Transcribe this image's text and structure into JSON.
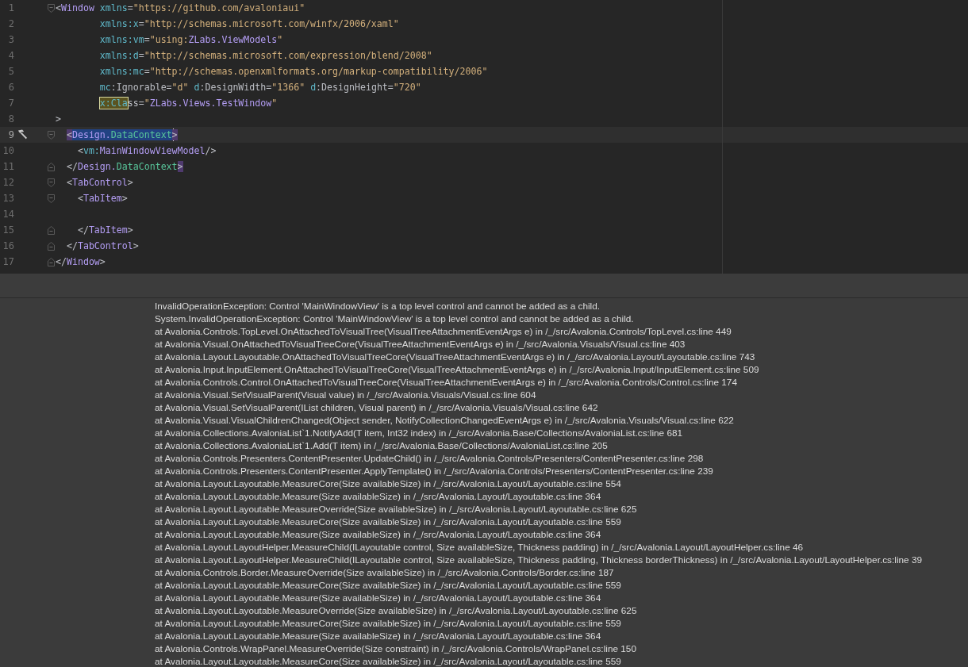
{
  "editor": {
    "lines": [
      {
        "number": "1",
        "fold_start": true,
        "fold_end": false,
        "current": false,
        "build_marker": false,
        "tokens": [
          {
            "kind": "punct",
            "text": "<"
          },
          {
            "kind": "tag",
            "text": "Window "
          },
          {
            "kind": "attr",
            "text": "xmlns"
          },
          {
            "kind": "punct",
            "text": "="
          },
          {
            "kind": "string",
            "text": "\"https://github.com/avaloniaui\""
          }
        ]
      },
      {
        "number": "2",
        "fold_start": false,
        "fold_end": false,
        "current": false,
        "build_marker": false,
        "tokens": [
          {
            "kind": "attr",
            "text": "        xmlns:x"
          },
          {
            "kind": "punct",
            "text": "="
          },
          {
            "kind": "string",
            "text": "\"http://schemas.microsoft.com/winfx/2006/xaml\""
          }
        ]
      },
      {
        "number": "3",
        "fold_start": false,
        "fold_end": false,
        "current": false,
        "build_marker": false,
        "tokens": [
          {
            "kind": "attr",
            "text": "        xmlns:vm"
          },
          {
            "kind": "punct",
            "text": "="
          },
          {
            "kind": "string",
            "text": "\"using:"
          },
          {
            "kind": "ref",
            "text": "ZLabs.ViewModels"
          },
          {
            "kind": "string",
            "text": "\""
          }
        ]
      },
      {
        "number": "4",
        "fold_start": false,
        "fold_end": false,
        "current": false,
        "build_marker": false,
        "tokens": [
          {
            "kind": "attr",
            "text": "        xmlns:d"
          },
          {
            "kind": "punct",
            "text": "="
          },
          {
            "kind": "string",
            "text": "\"http://schemas.microsoft.com/expression/blend/2008\""
          }
        ]
      },
      {
        "number": "5",
        "fold_start": false,
        "fold_end": false,
        "current": false,
        "build_marker": false,
        "tokens": [
          {
            "kind": "attr",
            "text": "        xmlns:mc"
          },
          {
            "kind": "punct",
            "text": "="
          },
          {
            "kind": "string",
            "text": "\"http://schemas.openxmlformats.org/markup-compatibility/2006\""
          }
        ]
      },
      {
        "number": "6",
        "fold_start": false,
        "fold_end": false,
        "current": false,
        "build_marker": false,
        "tokens": [
          {
            "kind": "attr",
            "text": "        mc"
          },
          {
            "kind": "punct",
            "text": ":Ignorable="
          },
          {
            "kind": "string",
            "text": "\"d\" "
          },
          {
            "kind": "attr",
            "text": "d"
          },
          {
            "kind": "punct",
            "text": ":DesignWidth="
          },
          {
            "kind": "string",
            "text": "\"1366\" "
          },
          {
            "kind": "attr",
            "text": "d"
          },
          {
            "kind": "punct",
            "text": ":DesignHeight="
          },
          {
            "kind": "string",
            "text": "\"720\""
          }
        ]
      },
      {
        "number": "7",
        "fold_start": false,
        "fold_end": false,
        "current": false,
        "build_marker": false,
        "tokens": [
          {
            "kind": "attr",
            "text": "        x:Cla",
            "search_match": true
          },
          {
            "kind": "punct",
            "text": "ss="
          },
          {
            "kind": "string",
            "text": "\""
          },
          {
            "kind": "ref",
            "text": "ZLabs.Views.TestWindow"
          },
          {
            "kind": "string",
            "text": "\""
          }
        ]
      },
      {
        "number": "8",
        "fold_start": false,
        "fold_end": false,
        "current": false,
        "build_marker": false,
        "tokens": [
          {
            "kind": "punct",
            "text": ">"
          }
        ]
      },
      {
        "number": "9",
        "fold_start": true,
        "fold_end": false,
        "current": true,
        "build_marker": true,
        "tokens": [
          {
            "kind": "punct",
            "text": "  <",
            "bracket_match": true
          },
          {
            "kind": "tag",
            "text": "Design.",
            "selected": true
          },
          {
            "kind": "green",
            "text": "DataContext",
            "selected": true,
            "caret": true
          },
          {
            "kind": "punct",
            "text": ">",
            "bracket_match": true
          }
        ]
      },
      {
        "number": "10",
        "fold_start": false,
        "fold_end": false,
        "current": false,
        "build_marker": false,
        "tokens": [
          {
            "kind": "punct",
            "text": "    <"
          },
          {
            "kind": "attr",
            "text": "vm:"
          },
          {
            "kind": "tag",
            "text": "MainWindowViewModel"
          },
          {
            "kind": "punct",
            "text": "/>"
          }
        ]
      },
      {
        "number": "11",
        "fold_start": false,
        "fold_end": true,
        "current": false,
        "build_marker": false,
        "tokens": [
          {
            "kind": "punct",
            "text": "  </"
          },
          {
            "kind": "tag",
            "text": "Design."
          },
          {
            "kind": "green",
            "text": "DataContext"
          },
          {
            "kind": "punct",
            "text": ">",
            "bracket_match": true
          }
        ]
      },
      {
        "number": "12",
        "fold_start": true,
        "fold_end": false,
        "current": false,
        "build_marker": false,
        "tokens": [
          {
            "kind": "punct",
            "text": "  <"
          },
          {
            "kind": "tag",
            "text": "TabControl"
          },
          {
            "kind": "punct",
            "text": ">"
          }
        ]
      },
      {
        "number": "13",
        "fold_start": true,
        "fold_end": false,
        "current": false,
        "build_marker": false,
        "tokens": [
          {
            "kind": "punct",
            "text": "    <"
          },
          {
            "kind": "tag",
            "text": "TabItem"
          },
          {
            "kind": "punct",
            "text": ">"
          }
        ]
      },
      {
        "number": "14",
        "fold_start": false,
        "fold_end": false,
        "current": false,
        "build_marker": false
      },
      {
        "number": "15",
        "fold_start": false,
        "fold_end": true,
        "current": false,
        "build_marker": false,
        "tokens": [
          {
            "kind": "punct",
            "text": "    </"
          },
          {
            "kind": "tag",
            "text": "TabItem"
          },
          {
            "kind": "punct",
            "text": ">"
          }
        ]
      },
      {
        "number": "16",
        "fold_start": false,
        "fold_end": true,
        "current": false,
        "build_marker": false,
        "tokens": [
          {
            "kind": "punct",
            "text": "  </"
          },
          {
            "kind": "tag",
            "text": "TabControl"
          },
          {
            "kind": "punct",
            "text": ">"
          }
        ]
      },
      {
        "number": "17",
        "fold_start": false,
        "fold_end": true,
        "current": false,
        "build_marker": false,
        "tokens": [
          {
            "kind": "punct",
            "text": "</"
          },
          {
            "kind": "tag",
            "text": "Window"
          },
          {
            "kind": "punct",
            "text": ">"
          }
        ]
      }
    ]
  },
  "error_panel": {
    "lines": [
      "InvalidOperationException: Control 'MainWindowView' is a top level control and cannot be added as a child.",
      "System.InvalidOperationException: Control 'MainWindowView' is a top level control and cannot be added as a child.",
      "at Avalonia.Controls.TopLevel.OnAttachedToVisualTree(VisualTreeAttachmentEventArgs e) in /_/src/Avalonia.Controls/TopLevel.cs:line 449",
      "at Avalonia.Visual.OnAttachedToVisualTreeCore(VisualTreeAttachmentEventArgs e) in /_/src/Avalonia.Visuals/Visual.cs:line 403",
      "at Avalonia.Layout.Layoutable.OnAttachedToVisualTreeCore(VisualTreeAttachmentEventArgs e) in /_/src/Avalonia.Layout/Layoutable.cs:line 743",
      "at Avalonia.Input.InputElement.OnAttachedToVisualTreeCore(VisualTreeAttachmentEventArgs e) in /_/src/Avalonia.Input/InputElement.cs:line 509",
      "at Avalonia.Controls.Control.OnAttachedToVisualTreeCore(VisualTreeAttachmentEventArgs e) in /_/src/Avalonia.Controls/Control.cs:line 174",
      "at Avalonia.Visual.SetVisualParent(Visual value) in /_/src/Avalonia.Visuals/Visual.cs:line 604",
      "at Avalonia.Visual.SetVisualParent(IList children, Visual parent) in /_/src/Avalonia.Visuals/Visual.cs:line 642",
      "at Avalonia.Visual.VisualChildrenChanged(Object sender, NotifyCollectionChangedEventArgs e) in /_/src/Avalonia.Visuals/Visual.cs:line 622",
      "at Avalonia.Collections.AvaloniaList`1.NotifyAdd(T item, Int32 index) in /_/src/Avalonia.Base/Collections/AvaloniaList.cs:line 681",
      "at Avalonia.Collections.AvaloniaList`1.Add(T item) in /_/src/Avalonia.Base/Collections/AvaloniaList.cs:line 205",
      "at Avalonia.Controls.Presenters.ContentPresenter.UpdateChild() in /_/src/Avalonia.Controls/Presenters/ContentPresenter.cs:line 298",
      "at Avalonia.Controls.Presenters.ContentPresenter.ApplyTemplate() in /_/src/Avalonia.Controls/Presenters/ContentPresenter.cs:line 239",
      "at Avalonia.Layout.Layoutable.MeasureCore(Size availableSize) in /_/src/Avalonia.Layout/Layoutable.cs:line 554",
      "at Avalonia.Layout.Layoutable.Measure(Size availableSize) in /_/src/Avalonia.Layout/Layoutable.cs:line 364",
      "at Avalonia.Layout.Layoutable.MeasureOverride(Size availableSize) in /_/src/Avalonia.Layout/Layoutable.cs:line 625",
      "at Avalonia.Layout.Layoutable.MeasureCore(Size availableSize) in /_/src/Avalonia.Layout/Layoutable.cs:line 559",
      "at Avalonia.Layout.Layoutable.Measure(Size availableSize) in /_/src/Avalonia.Layout/Layoutable.cs:line 364",
      "at Avalonia.Layout.LayoutHelper.MeasureChild(ILayoutable control, Size availableSize, Thickness padding) in /_/src/Avalonia.Layout/LayoutHelper.cs:line 46",
      "at Avalonia.Layout.LayoutHelper.MeasureChild(ILayoutable control, Size availableSize, Thickness padding, Thickness borderThickness) in /_/src/Avalonia.Layout/LayoutHelper.cs:line 39",
      "at Avalonia.Controls.Border.MeasureOverride(Size availableSize) in /_/src/Avalonia.Controls/Border.cs:line 187",
      "at Avalonia.Layout.Layoutable.MeasureCore(Size availableSize) in /_/src/Avalonia.Layout/Layoutable.cs:line 559",
      "at Avalonia.Layout.Layoutable.Measure(Size availableSize) in /_/src/Avalonia.Layout/Layoutable.cs:line 364",
      "at Avalonia.Layout.Layoutable.MeasureOverride(Size availableSize) in /_/src/Avalonia.Layout/Layoutable.cs:line 625",
      "at Avalonia.Layout.Layoutable.MeasureCore(Size availableSize) in /_/src/Avalonia.Layout/Layoutable.cs:line 559",
      "at Avalonia.Layout.Layoutable.Measure(Size availableSize) in /_/src/Avalonia.Layout/Layoutable.cs:line 364",
      "at Avalonia.Controls.WrapPanel.MeasureOverride(Size constraint) in /_/src/Avalonia.Controls/WrapPanel.cs:line 150",
      "at Avalonia.Layout.Layoutable.MeasureCore(Size availableSize) in /_/src/Avalonia.Layout/Layoutable.cs:line 559"
    ]
  }
}
